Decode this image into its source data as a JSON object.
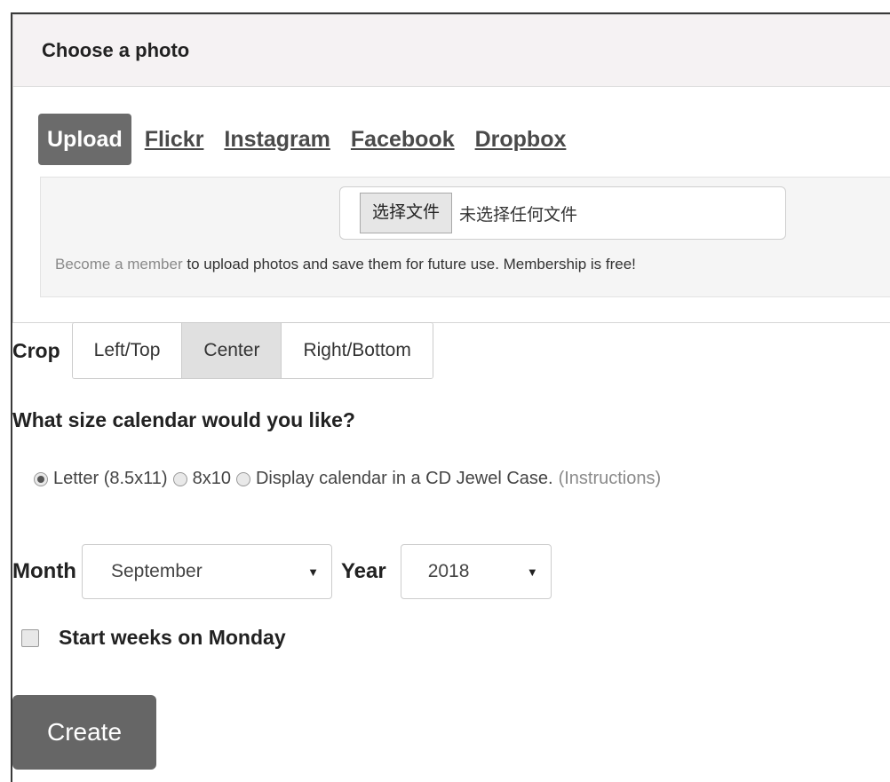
{
  "photo_panel": {
    "title": "Choose a photo",
    "source_tabs": [
      {
        "label": "Upload",
        "active": true
      },
      {
        "label": "Flickr",
        "active": false
      },
      {
        "label": "Instagram",
        "active": false
      },
      {
        "label": "Facebook",
        "active": false
      },
      {
        "label": "Dropbox",
        "active": false
      }
    ],
    "file_input": {
      "button_label": "选择文件",
      "status": "未选择任何文件"
    },
    "membership_note": {
      "link_text": "Become a member",
      "text": " to upload photos and save them for future use. Membership is free!"
    }
  },
  "crop": {
    "label": "Crop",
    "options": [
      {
        "label": "Left/Top",
        "active": false
      },
      {
        "label": "Center",
        "active": true
      },
      {
        "label": "Right/Bottom",
        "active": false
      }
    ]
  },
  "size": {
    "heading": "What size calendar would you like?",
    "options": [
      {
        "label": "Letter (8.5x11)",
        "checked": true
      },
      {
        "label": "8x10",
        "checked": false
      },
      {
        "label": "Display calendar in a CD Jewel Case.",
        "checked": false
      }
    ],
    "instructions_link": "(Instructions)"
  },
  "date": {
    "month_label": "Month",
    "month_value": "September",
    "year_label": "Year",
    "year_value": "2018"
  },
  "week_start": {
    "label": "Start weeks on Monday",
    "checked": false
  },
  "create_button": "Create",
  "colors": {
    "active_tab_bg": "#6b6b6b",
    "heading_bg": "#f5f2f3",
    "create_bg": "#666666"
  }
}
